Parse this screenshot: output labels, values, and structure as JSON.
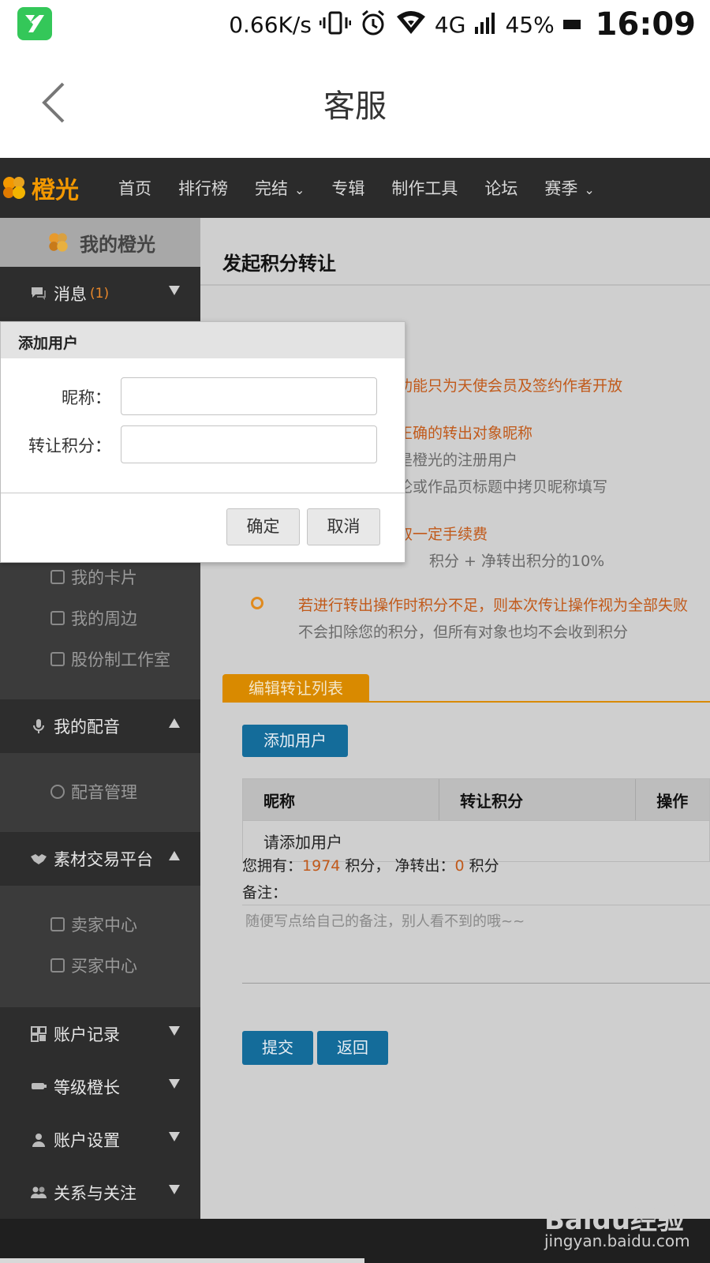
{
  "status_bar": {
    "net_speed": "0.66K/s",
    "network": "4G",
    "battery": "45%",
    "time": "16:09"
  },
  "appbar": {
    "title": "客服"
  },
  "site": {
    "logo_text": "橙光",
    "nav": [
      {
        "label": "首页",
        "has_dropdown": false
      },
      {
        "label": "排行榜",
        "has_dropdown": false
      },
      {
        "label": "完结",
        "has_dropdown": true
      },
      {
        "label": "专辑",
        "has_dropdown": false
      },
      {
        "label": "制作工具",
        "has_dropdown": false
      },
      {
        "label": "论坛",
        "has_dropdown": false
      },
      {
        "label": "赛季",
        "has_dropdown": true
      }
    ]
  },
  "sidebar": {
    "header": "我的橙光",
    "messages": {
      "label": "消息",
      "count": "(1)"
    },
    "sub_items_top": [
      {
        "label": "我的卡片",
        "icon": "card-icon"
      },
      {
        "label": "我的周边",
        "icon": "merch-icon"
      },
      {
        "label": "股份制工作室",
        "icon": "studio-icon"
      }
    ],
    "dubbing": {
      "label": "我的配音",
      "items": [
        {
          "label": "配音管理",
          "icon": "audio-icon"
        }
      ]
    },
    "market": {
      "label": "素材交易平台",
      "items": [
        {
          "label": "卖家中心",
          "icon": "seller-icon"
        },
        {
          "label": "买家中心",
          "icon": "buyer-icon"
        }
      ]
    },
    "sections_bottom": [
      {
        "label": "账户记录",
        "icon": "records-icon"
      },
      {
        "label": "等级橙长",
        "icon": "level-icon"
      },
      {
        "label": "账户设置",
        "icon": "user-icon"
      },
      {
        "label": "关系与关注",
        "icon": "follow-icon"
      }
    ]
  },
  "main": {
    "title": "发起积分转让",
    "notices": [
      {
        "text": "功能只为天使会员及签约作者开放",
        "tone": "orange"
      },
      {
        "text": "正确的转出对象昵称",
        "tone": "orange"
      },
      {
        "text": "是橙光的注册用户",
        "tone": "gray"
      },
      {
        "text": "论或作品页标题中拷贝昵称填写",
        "tone": "gray"
      },
      {
        "text": "取一定手续费",
        "tone": "orange"
      },
      {
        "text": "积分 + 净转出积分的10%",
        "tone": "gray"
      },
      {
        "text": "若进行转出操作时积分不足，则本次传让操作视为全部失败",
        "tone": "orange"
      },
      {
        "text": "不会扣除您的积分，但所有对象也均不会收到积分",
        "tone": "gray"
      }
    ],
    "tab_label": "编辑转让列表",
    "add_user_button": "添加用户",
    "table": {
      "headers": [
        "昵称",
        "转让积分",
        "操作"
      ],
      "empty_text": "请添加用户"
    },
    "summary": {
      "own_prefix": "您拥有：",
      "own_value": "1974",
      "own_suffix": "积分，",
      "out_prefix": "净转出：",
      "out_value": "0",
      "out_suffix": "积分"
    },
    "remark_label": "备注：",
    "remark_placeholder": "随便写点给自己的备注，别人看不到的哦~~",
    "submit_button": "提交",
    "back_button": "返回"
  },
  "modal": {
    "title": "添加用户",
    "nickname_label": "昵称：",
    "nickname_value": "",
    "points_label": "转让积分：",
    "points_value": "",
    "ok_button": "确定",
    "cancel_button": "取消"
  },
  "watermark": {
    "brand": "Baidu经验",
    "url": "jingyan.baidu.com"
  },
  "colors": {
    "accent_orange": "#d98a00",
    "primary_blue": "#146c9a",
    "nav_bg": "#2b2b2b",
    "sidebar_bg": "#3b3b3b"
  }
}
